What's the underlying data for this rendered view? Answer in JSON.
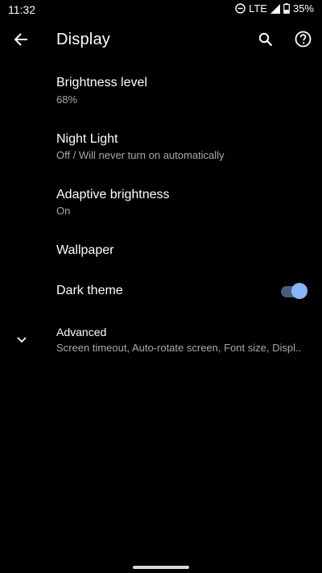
{
  "status_bar": {
    "time": "11:32",
    "network": "LTE",
    "battery": "35%",
    "icons": [
      "do-not-disturb-icon",
      "signal-icon",
      "battery-icon"
    ]
  },
  "app_bar": {
    "title": "Display",
    "icons": [
      "back-arrow-icon",
      "search-icon",
      "help-icon"
    ]
  },
  "settings": {
    "brightness": {
      "title": "Brightness level",
      "summary": "68%"
    },
    "night_light": {
      "title": "Night Light",
      "summary": "Off / Will never turn on automatically"
    },
    "adaptive": {
      "title": "Adaptive brightness",
      "summary": "On"
    },
    "wallpaper": {
      "title": "Wallpaper"
    },
    "dark_theme": {
      "title": "Dark theme",
      "enabled": true
    },
    "advanced": {
      "title": "Advanced",
      "summary": "Screen timeout, Auto-rotate screen, Font size, Displ.."
    }
  },
  "colors": {
    "background": "#000000",
    "text_primary": "#ffffff",
    "text_secondary": "#a8a8a8",
    "accent": "#8ab4f8",
    "toggle_track": "#4a5b7d"
  }
}
